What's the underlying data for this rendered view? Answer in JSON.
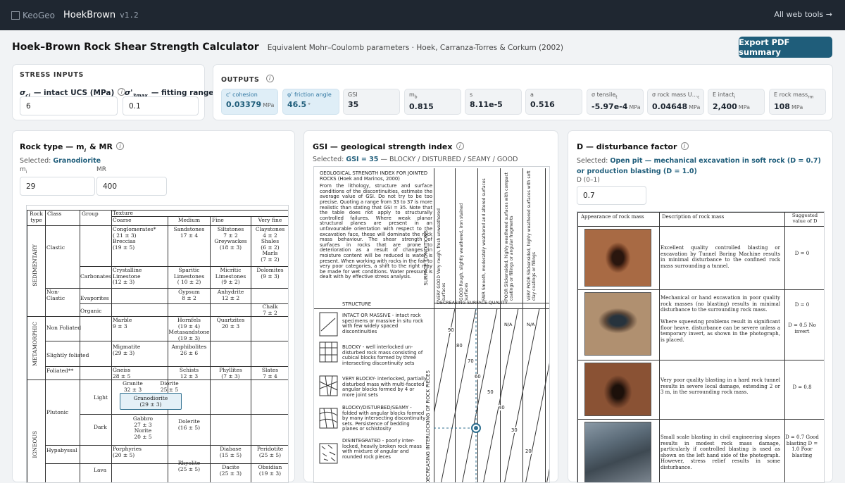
{
  "topbar": {
    "logo_text": "KeoGeo",
    "app_name": "HoekBrown",
    "version": "v1.2",
    "all_tools": "All web tools →"
  },
  "header": {
    "title": "Hoek–Brown Rock Shear Strength Calculator",
    "subtitle": "Equivalent Mohr–Coulomb parameters · Hoek, Carranza-Torres & Corkum (2002)",
    "export_label": "Export PDF summary"
  },
  "stress": {
    "heading": "STRESS INPUTS",
    "ucs_label": "— intact UCS (MPa)",
    "ucs_value": "6",
    "s3_label": "— fitting range (MPa)",
    "s3_value": "0.1"
  },
  "outputs": {
    "heading": "OUTPUTS",
    "tiles": [
      {
        "label": "c' cohesion",
        "value": "0.03379",
        "unit": "MPa"
      },
      {
        "label": "φ' friction angle",
        "value": "46.5",
        "unit": "°"
      },
      {
        "label": "GSI",
        "value": "35",
        "unit": ""
      },
      {
        "label": "m",
        "sub": "b",
        "value": "0.815",
        "unit": ""
      },
      {
        "label": "s",
        "value": "8.11e-5",
        "unit": ""
      },
      {
        "label": "a",
        "value": "0.516",
        "unit": ""
      },
      {
        "label": "σ tensile",
        "sub": "t",
        "value": "-5.97e-4",
        "unit": "MPa"
      },
      {
        "label": "σ rock mass U...",
        "sub": "c",
        "value": "0.04648",
        "unit": "MPa"
      },
      {
        "label": "E intact",
        "sub": "i",
        "value": "2,400",
        "unit": "MPa"
      },
      {
        "label": "E rock mass",
        "sub": "rm",
        "value": "108",
        "unit": "MPa"
      }
    ]
  },
  "rock": {
    "title": "Rock type — m",
    "title_sub": "i",
    "title_tail": "& MR",
    "selected_prefix": "Selected:",
    "selected": "Granodiorite",
    "mi_label": "m",
    "mi_sub": "i",
    "mi_value": "29",
    "mr_label": "MR",
    "mr_value": "400",
    "table": {
      "h_type": "Rock type",
      "h_class": "Class",
      "h_group": "Group",
      "h_texture": "Texture",
      "h_coarse": "Coarse",
      "h_medium": "Medium",
      "h_fine": "Fine",
      "h_vfine": "Very fine",
      "sed": "SEDIMENTARY",
      "meta": "METAMORPHIC",
      "ign": "IGNEOUS",
      "clastic": "Clastic",
      "nonclastic": "Non-Clastic",
      "carbonates": "Carbonates",
      "evaporites": "Evaporites",
      "organic": "Organic",
      "nonfoliated": "Non Foliated",
      "slightly": "Slightly foliated",
      "foliated": "Foliated**",
      "plutonic": "Plutonic",
      "light": "Light",
      "dark": "Dark",
      "hypabyssal": "Hypabyssal",
      "lava": "Lava",
      "conglom": "Conglomerates*",
      "conglom_v": "( 21 ± 3)",
      "breccias": "Breccias",
      "breccias_v": "(19 ± 5)",
      "sandstones": "Sandstones",
      "sandstones_v": "17 ± 4",
      "siltstones": "Siltstones",
      "siltstones_v": "7 ± 2",
      "greywackes": "Greywackes",
      "greywackes_v": "(18 ± 3)",
      "claystones": "Claystones",
      "claystones_v": "4 ± 2",
      "shales": "Shales",
      "shales_v": "(6 ± 2)",
      "marls": "Marls",
      "marls_v": "(7 ± 2)",
      "crystalline": "Crystalline",
      "crystalline2": "Limestone",
      "crystalline_v": "(12 ± 3)",
      "sparitic": "Sparitic",
      "sparitic2": "Limestones",
      "sparitic_v": "( 10 ± 2)",
      "micritic": "Micritic",
      "micritic2": "Limestones",
      "micritic_v": "(9 ± 2)",
      "dolomites": "Dolomites",
      "dolomites_v": "(9 ± 3)",
      "gypsum": "Gypsum",
      "gypsum_v": "8 ± 2",
      "anhydrite": "Anhydrite",
      "anhydrite_v": "12 ± 2",
      "chalk": "Chalk",
      "chalk_v": "7 ± 2",
      "marble": "Marble",
      "marble_v": "9 ± 3",
      "hornfels": "Hornfels",
      "hornfels_v": "(19 ± 4)",
      "metasand": "Metasandstone",
      "metasand_v": "(19 ± 3)",
      "quartzites": "Quartzites",
      "quartzites_v": "20 ± 3",
      "migmatite": "Migmatite",
      "migmatite_v": "(29 ± 3)",
      "amphib": "Amphibolites",
      "amphib_v": "26 ± 6",
      "gneiss": "Gneiss",
      "gneiss_v": "28 ± 5",
      "schists": "Schists",
      "schists_v": "12 ± 3",
      "phyllites": "Phyllites",
      "phyllites_v": "(7 ± 3)",
      "slates": "Slates",
      "slates_v": "7 ± 4",
      "granite": "Granite",
      "granite_v": "32 ± 3",
      "diorite": "Diorite",
      "diorite_v": "25 ± 5",
      "granodiorite": "Granodiorite",
      "granodiorite_v": "(29 ± 3)",
      "gabbro": "Gabbro",
      "gabbro_v": "27 ± 3",
      "norite": "Norite",
      "norite_v": "20 ± 5",
      "dolerite": "Dolerite",
      "dolerite_v": "(16 ± 5)",
      "porphyries": "Porphyries",
      "porphyries_v": "(20 ± 5)",
      "diabase": "Diabase",
      "diabase_v": "(15 ± 5)",
      "peridotite": "Peridotite",
      "peridotite_v": "(25 ± 5)",
      "rhyolite": "Rhyolite",
      "rhyolite_v": "(25 ± 5)",
      "dacite": "Dacite",
      "dacite_v": "(25 ± 3)",
      "obsidian": "Obsidian",
      "obsidian_v": "(19 ± 3)"
    }
  },
  "gsi": {
    "title": "GSI — geological strength index",
    "selected_prefix": "Selected:",
    "selected": "GSI = 35",
    "selected_tail": "— BLOCKY / DISTURBED / SEAMY / GOOD",
    "chart_title": "GEOLOGICAL STRENGTH INDEX FOR JOINTED ROCKS (Hoek and Marinos, 2000)",
    "chart_desc": "From the lithology, structure and surface conditions of the discontinuities, estimate the average value of GSI. Do not try to be too precise. Quoting a range from 33 to 37 is more realistic than stating that GSI = 35. Note that the table does not apply to structurally controlled failures. Where weak planar structural planes are present in an unfavourable orientation with respect to the excavation face, these will dominate the rock mass behaviour. The shear strength of surfaces in rocks that are prone to deterioration as a result of changes in moisture content will be reduced is water is present. When working with rocks in the fair to very poor categories, a shift to the right may be made for wet conditions. Water pressure is dealt with by effective stress analysis.",
    "surface_conditions": "SURFACE CONDITIONS",
    "col_vg": "VERY GOOD Very rough, fresh unweathered surfaces",
    "col_g": "GOOD Rough, slightly weathered, iron stained surfaces",
    "col_f": "FAIR Smooth, moderately weathered and altered surfaces",
    "col_p": "POOR Slickensided, highly weathered surfaces with compact coatings or fillings or angular fragments",
    "col_vp": "VERY POOR Slickensided, highly weathered surfaces with soft clay coatings or fillings",
    "structure": "STRUCTURE",
    "decreasing_surface": "DECREASING SURFACE QUALITY",
    "decreasing_interlock": "DECREASING INTERLOCKING OF ROCK PIECES",
    "rows": [
      "INTACT OR MASSIVE - intact rock specimens or massive in situ rock with few widely spaced discontinuities",
      "BLOCKY - well interlocked un-disturbed rock mass consisting of cubical blocks formed by three intersecting discontinuity sets",
      "VERY BLOCKY- interlocked, partially disturbed mass with multi-faceted angular blocks formed by 4 or more joint sets",
      "BLOCKY/DISTURBED/SEAMY - folded with angular blocks formed by many intersecting discontinuity sets. Persistence of bedding planes or schistosity",
      "DISINTEGRATED - poorly inter-locked, heavily broken rock mass with mixture of angular and rounded rock pieces"
    ],
    "na": "N/A",
    "contours": [
      "90",
      "80",
      "70",
      "60",
      "50",
      "40",
      "30",
      "20"
    ]
  },
  "disturb": {
    "title": "D — disturbance factor",
    "selected_prefix": "Selected:",
    "selected": "Open pit — mechanical excavation in soft rock (D = 0.7) or production blasting (D = 1.0)",
    "d_label": "D (0–1)",
    "d_value": "0.7",
    "h_appearance": "Appearance of rock mass",
    "h_description": "Description of rock mass",
    "h_value": "Suggested value of D",
    "rows": [
      {
        "desc": "Excellent quality controlled blasting or excavation by Tunnel Boring Machine results in minimal disturbance to the confined rock mass surrounding a tunnel.",
        "val": "D = 0"
      },
      {
        "desc": "Mechanical or hand excavation in poor quality rock masses (no blasting) results in minimal disturbance to the surrounding rock mass.",
        "val": "D = 0"
      },
      {
        "desc": "Where squeezing problems result in significant floor heave, disturbance can be severe unless a temporary invert, as shown in the photograph, is placed.",
        "val": "D = 0.5 No invert"
      },
      {
        "desc": "Very poor quality blasting in a hard rock tunnel results in severe local damage, extending 2 or 3 m, in the surrounding rock mass.",
        "val": "D = 0.8"
      },
      {
        "desc": "Small scale blasting in civil engineering slopes results in modest rock mass damage, particularly if controlled blasting is used as shown on the left hand side of the photograph. However, stress relief results in some disturbance.",
        "val": "D = 0.7 Good blasting D = 1.0 Poor blasting"
      }
    ]
  }
}
